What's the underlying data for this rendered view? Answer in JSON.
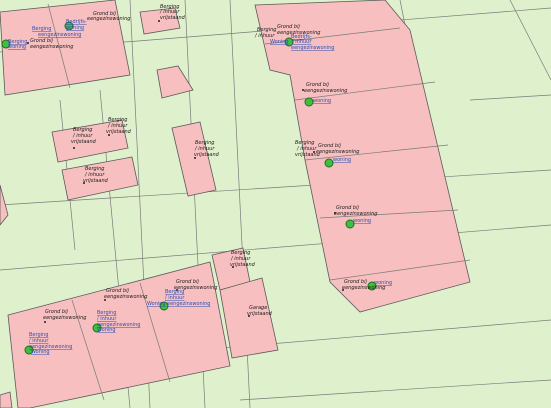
{
  "labels": {
    "grond_bij": "Grond bij",
    "eengezinswoning": "eengezinswoning",
    "berging": "Berging",
    "inhuur": "/ inhuur",
    "vrijstaand": "vrijstaand",
    "garage": "Garage",
    "woning": "woning",
    "bedrijfs": "Bedrijfs-",
    "garage_link": "garage",
    "eengezinswoning_link": "eengezinswoning",
    "woning_link": "Woning"
  },
  "colors": {
    "background": "#dff0cc",
    "lot_fill": "#f7bfbf",
    "marker": "#3fbf3f",
    "link": "#2b4fb5"
  }
}
